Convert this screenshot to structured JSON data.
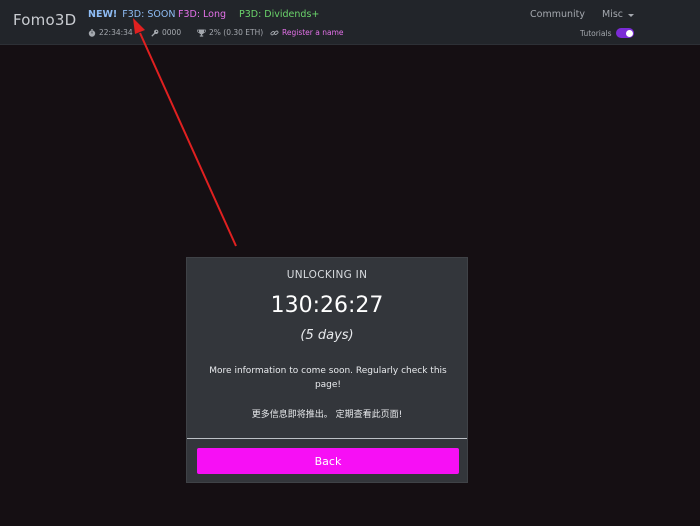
{
  "navbar": {
    "brand": "Fomo3D",
    "new_tag": "NEW!",
    "soon_link": "F3D: SOON",
    "long_link": "F3D: Long",
    "dividends_link": "P3D: Dividends+",
    "community": "Community",
    "misc": "Misc",
    "tutorials": "Tutorials",
    "tutorials_enabled": true
  },
  "stats": {
    "timer": "22:34:34",
    "keys": "0000",
    "share": "2% (0.30 ETH)",
    "register": "Register a name"
  },
  "modal": {
    "header": "UNLOCKING IN",
    "countdown": "130:26:27",
    "days": "(5 days)",
    "info_en": "More information to come soon. Regularly check this page!",
    "info_cn": "更多信息即将推出。 定期查看此页面!",
    "back_label": "Back"
  },
  "colors": {
    "background": "#150f13",
    "navbar": "#22252a",
    "card": "#33363b",
    "accent_magenta": "#f70ff5",
    "link_blue": "#8ebcf4",
    "link_pink": "#e371e8",
    "link_green": "#6bd46b",
    "toggle_purple": "#7b2bd6",
    "annotation_arrow": "#e02020"
  }
}
